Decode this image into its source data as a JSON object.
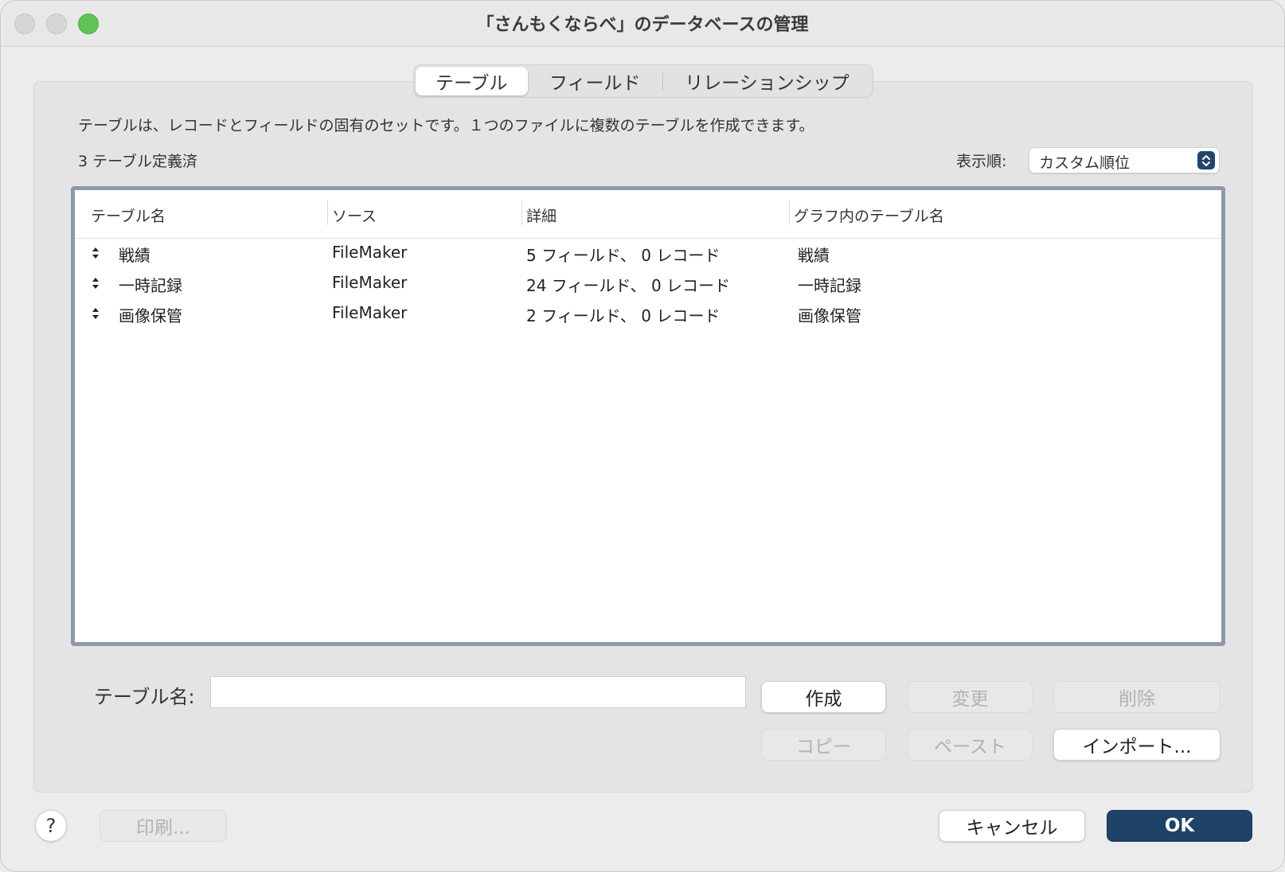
{
  "window": {
    "title": "「さんもくならべ」のデータベースの管理"
  },
  "tabs": [
    {
      "label": "テーブル",
      "active": true
    },
    {
      "label": "フィールド",
      "active": false
    },
    {
      "label": "リレーションシップ",
      "active": false
    }
  ],
  "description": "テーブルは、レコードとフィールドの固有のセットです。１つのファイルに複数のテーブルを作成できます。",
  "table_count": "3 テーブル定義済",
  "sort": {
    "label": "表示順:",
    "value": "カスタム順位"
  },
  "table": {
    "columns": [
      "テーブル名",
      "ソース",
      "詳細",
      "グラフ内のテーブル名"
    ],
    "rows": [
      {
        "name": "戦績",
        "source": "FileMaker",
        "details": "5 フィールド、 0 レコード",
        "graph_name": "戦績"
      },
      {
        "name": "一時記録",
        "source": "FileMaker",
        "details": "24 フィールド、 0 レコード",
        "graph_name": "一時記録"
      },
      {
        "name": "画像保管",
        "source": "FileMaker",
        "details": "2 フィールド、 0 レコード",
        "graph_name": "画像保管"
      }
    ]
  },
  "name_field": {
    "label": "テーブル名:",
    "value": ""
  },
  "buttons": {
    "create": "作成",
    "change": "変更",
    "delete": "削除",
    "copy": "コピー",
    "paste": "ペースト",
    "import": "インポート...",
    "help": "?",
    "print": "印刷...",
    "cancel": "キャンセル",
    "ok": "OK"
  },
  "colors": {
    "accent": "#1f4268",
    "zoom_button": "#5fc454",
    "table_border": "#8e9aa7"
  }
}
